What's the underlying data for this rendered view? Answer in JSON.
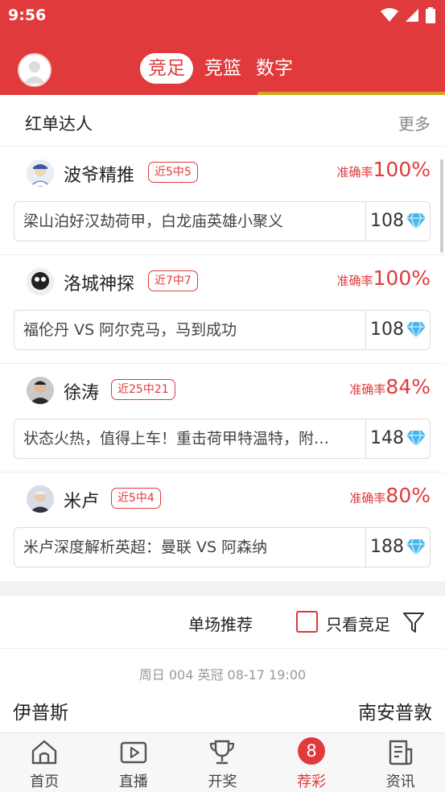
{
  "status_bar": {
    "time": "9:56"
  },
  "header": {
    "tabs": [
      {
        "label": "竞足",
        "active": true
      },
      {
        "label": "竞篮",
        "active": false
      },
      {
        "label": "数字",
        "active": false
      }
    ],
    "accent_color": "#e03a3c"
  },
  "section": {
    "title": "红单达人",
    "more_label": "更多",
    "rate_label": "准确率",
    "experts": [
      {
        "name": "波爷精推",
        "badge": "近5中5",
        "rate": "100%",
        "text": "梁山泊好汉劫荷甲，白龙庙英雄小聚义",
        "price": "108"
      },
      {
        "name": "洛城神探",
        "badge": "近7中7",
        "rate": "100%",
        "text": "福伦丹 VS 阿尔克马，马到成功",
        "price": "108"
      },
      {
        "name": "徐涛",
        "badge": "近25中21",
        "rate": "84%",
        "text": "状态火热，值得上车！重击荷甲特温特，附…",
        "price": "148"
      },
      {
        "name": "米卢",
        "badge": "近5中4",
        "rate": "80%",
        "text": "米卢深度解析英超：曼联 VS 阿森纳",
        "price": "188"
      }
    ]
  },
  "filter": {
    "label": "单场推荐",
    "only_label": "只看竞足",
    "only_checked": false
  },
  "match": {
    "info": "周日 004 英冠 08-17 19:00",
    "home": "伊普斯",
    "away": "南安普敦"
  },
  "bottom_nav": {
    "items": [
      {
        "label": "首页",
        "icon": "home-icon"
      },
      {
        "label": "直播",
        "icon": "play-icon"
      },
      {
        "label": "开奖",
        "icon": "trophy-icon"
      },
      {
        "label": "荐彩",
        "icon": "badge-8",
        "badge": "8",
        "active": true
      },
      {
        "label": "资讯",
        "icon": "news-icon"
      }
    ]
  }
}
